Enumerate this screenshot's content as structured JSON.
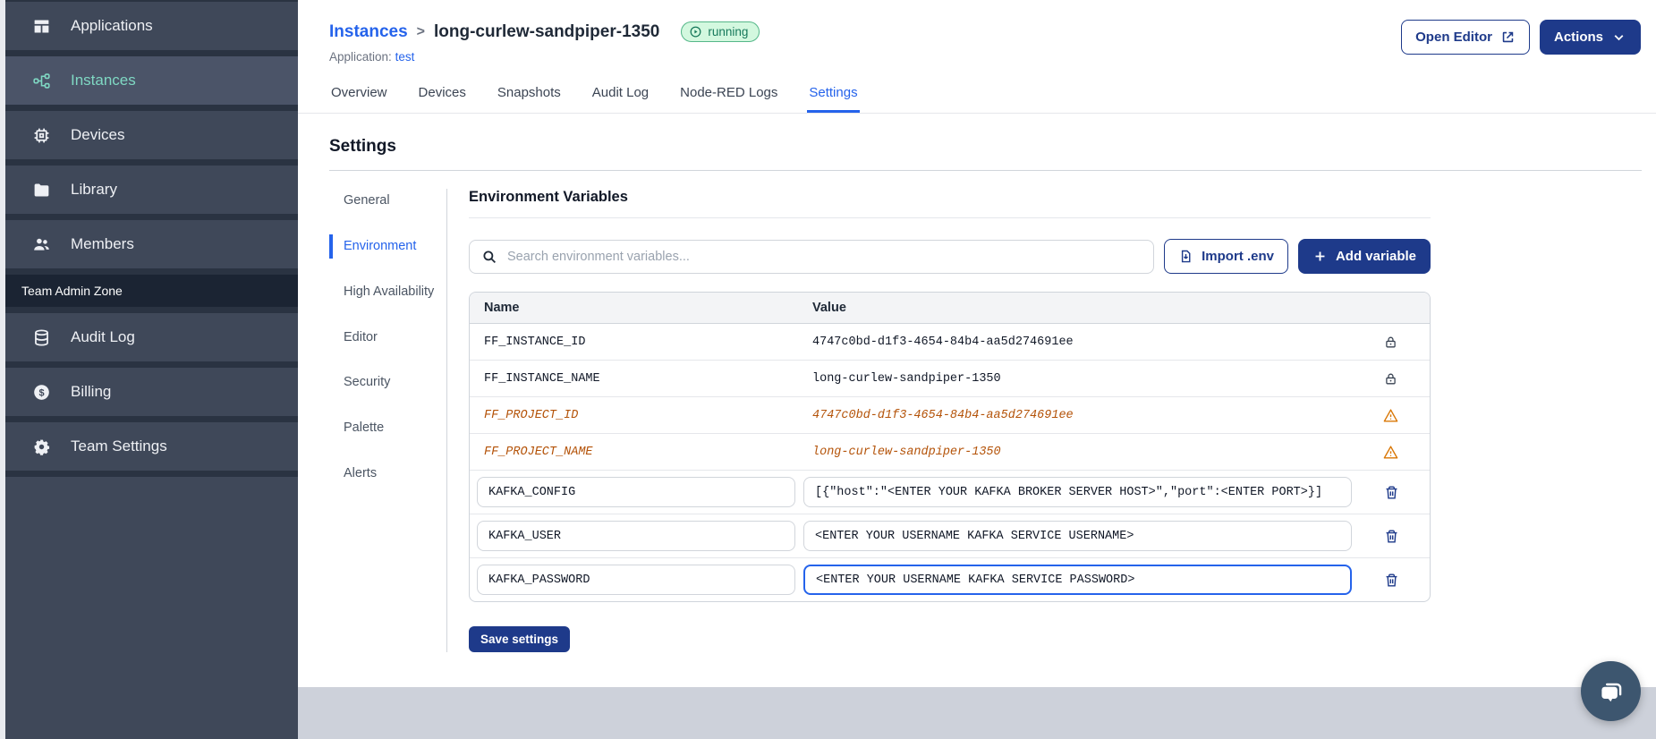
{
  "colors": {
    "accent_navy": "#1e3a8a",
    "link_blue": "#2563eb",
    "sidebar_bg": "#3f4859",
    "sidebar_active_teal": "#7fd8c3",
    "running_badge_bg": "#d3f8df",
    "running_badge_border": "#55b789",
    "running_badge_text": "#17795b",
    "deprecated_orange": "#b45309",
    "footer_strip_gray": "#cdd1da",
    "chat_fab_bg": "#3d566f"
  },
  "sidebar": {
    "items": [
      {
        "label": "Applications",
        "icon": "applications-icon"
      },
      {
        "label": "Instances",
        "icon": "instances-icon",
        "active": true
      },
      {
        "label": "Devices",
        "icon": "devices-icon"
      },
      {
        "label": "Library",
        "icon": "library-icon"
      },
      {
        "label": "Members",
        "icon": "members-icon"
      }
    ],
    "section_label": "Team Admin Zone",
    "admin_items": [
      {
        "label": "Audit Log",
        "icon": "audit-log-icon"
      },
      {
        "label": "Billing",
        "icon": "billing-icon"
      },
      {
        "label": "Team Settings",
        "icon": "team-settings-icon"
      }
    ],
    "billing_symbol": "$"
  },
  "header": {
    "breadcrumb_root": "Instances",
    "breadcrumb_separator": ">",
    "instance_name": "long-curlew-sandpiper-1350",
    "status": "running",
    "application_label": "Application:",
    "application_name": "test",
    "open_editor_button": "Open Editor",
    "actions_button": "Actions"
  },
  "tabs": [
    {
      "label": "Overview"
    },
    {
      "label": "Devices"
    },
    {
      "label": "Snapshots"
    },
    {
      "label": "Audit Log"
    },
    {
      "label": "Node-RED Logs"
    },
    {
      "label": "Settings",
      "active": true
    }
  ],
  "settings": {
    "title": "Settings",
    "nav": [
      {
        "label": "General"
      },
      {
        "label": "Environment",
        "active": true
      },
      {
        "label": "High Availability"
      },
      {
        "label": "Editor"
      },
      {
        "label": "Security"
      },
      {
        "label": "Palette"
      },
      {
        "label": "Alerts"
      }
    ],
    "section_title": "Environment Variables",
    "search_placeholder": "Search environment variables...",
    "import_button": "Import .env",
    "add_button": "Add variable",
    "save_button": "Save settings",
    "table": {
      "columns": [
        "Name",
        "Value"
      ],
      "rows": [
        {
          "name": "FF_INSTANCE_ID",
          "value": "4747c0bd-d1f3-4654-84b4-aa5d274691ee",
          "state": "locked"
        },
        {
          "name": "FF_INSTANCE_NAME",
          "value": "long-curlew-sandpiper-1350",
          "state": "locked"
        },
        {
          "name": "FF_PROJECT_ID",
          "value": "4747c0bd-d1f3-4654-84b4-aa5d274691ee",
          "state": "deprecated"
        },
        {
          "name": "FF_PROJECT_NAME",
          "value": "long-curlew-sandpiper-1350",
          "state": "deprecated"
        },
        {
          "name": "KAFKA_CONFIG",
          "value": "[{\"host\":\"<ENTER YOUR KAFKA BROKER SERVER HOST>\",\"port\":<ENTER PORT>}]",
          "state": "editable"
        },
        {
          "name": "KAFKA_USER",
          "value": "<ENTER YOUR USERNAME KAFKA SERVICE USERNAME>",
          "state": "editable"
        },
        {
          "name": "KAFKA_PASSWORD",
          "value": "<ENTER YOUR USERNAME KAFKA SERVICE PASSWORD>",
          "state": "editable",
          "focused": true
        }
      ]
    }
  }
}
